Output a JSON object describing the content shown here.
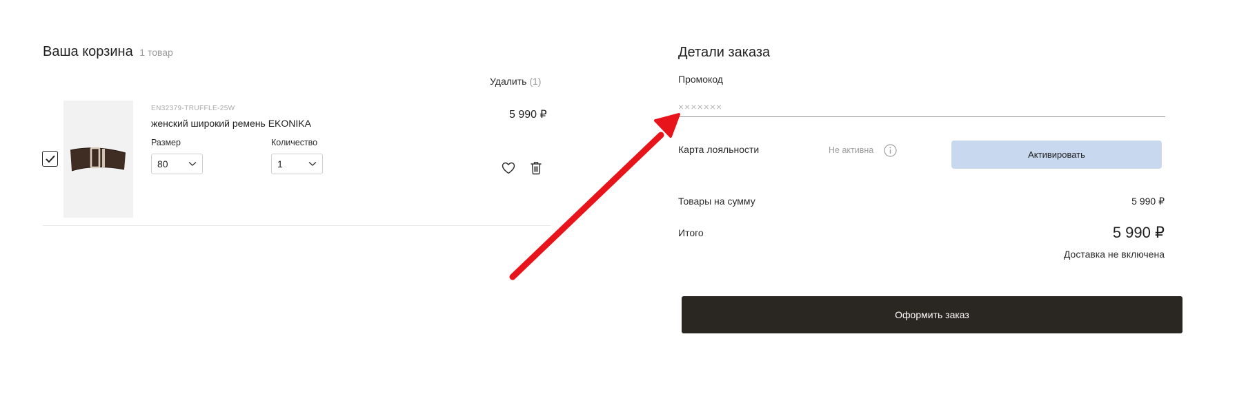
{
  "cart": {
    "title": "Ваша корзина",
    "count_text": "1 товар",
    "delete_label": "Удалить",
    "delete_count": "(1)",
    "item": {
      "selected": true,
      "sku": "EN32379-TRUFFLE-25W",
      "name": "женский широкий ремень EKONIKA",
      "size_label": "Размер",
      "size_value": "80",
      "qty_label": "Количество",
      "qty_value": "1",
      "price": "5 990 ₽",
      "product_color": "#3f2c22"
    }
  },
  "order": {
    "title": "Детали заказа",
    "promo_label": "Промокод",
    "promo_value": "",
    "promo_placeholder": "×××××××",
    "loyalty_label": "Карта лояльности",
    "loyalty_status": "Не активна",
    "activate_label": "Активировать",
    "goods_sum_label": "Товары на сумму",
    "goods_sum_value": "5 990 ₽",
    "total_label": "Итого",
    "total_value": "5 990 ₽",
    "delivery_note": "Доставка не включена",
    "checkout_label": "Оформить заказ"
  },
  "colors": {
    "activate_bg": "#c7d8ef",
    "checkout_bg": "#2a2622",
    "annotation_arrow": "#e8141b"
  },
  "icons": {
    "checkbox": "check-icon",
    "heart": "heart-icon",
    "trash": "trash-icon",
    "info": "info-icon",
    "chevron": "chevron-down-icon"
  }
}
